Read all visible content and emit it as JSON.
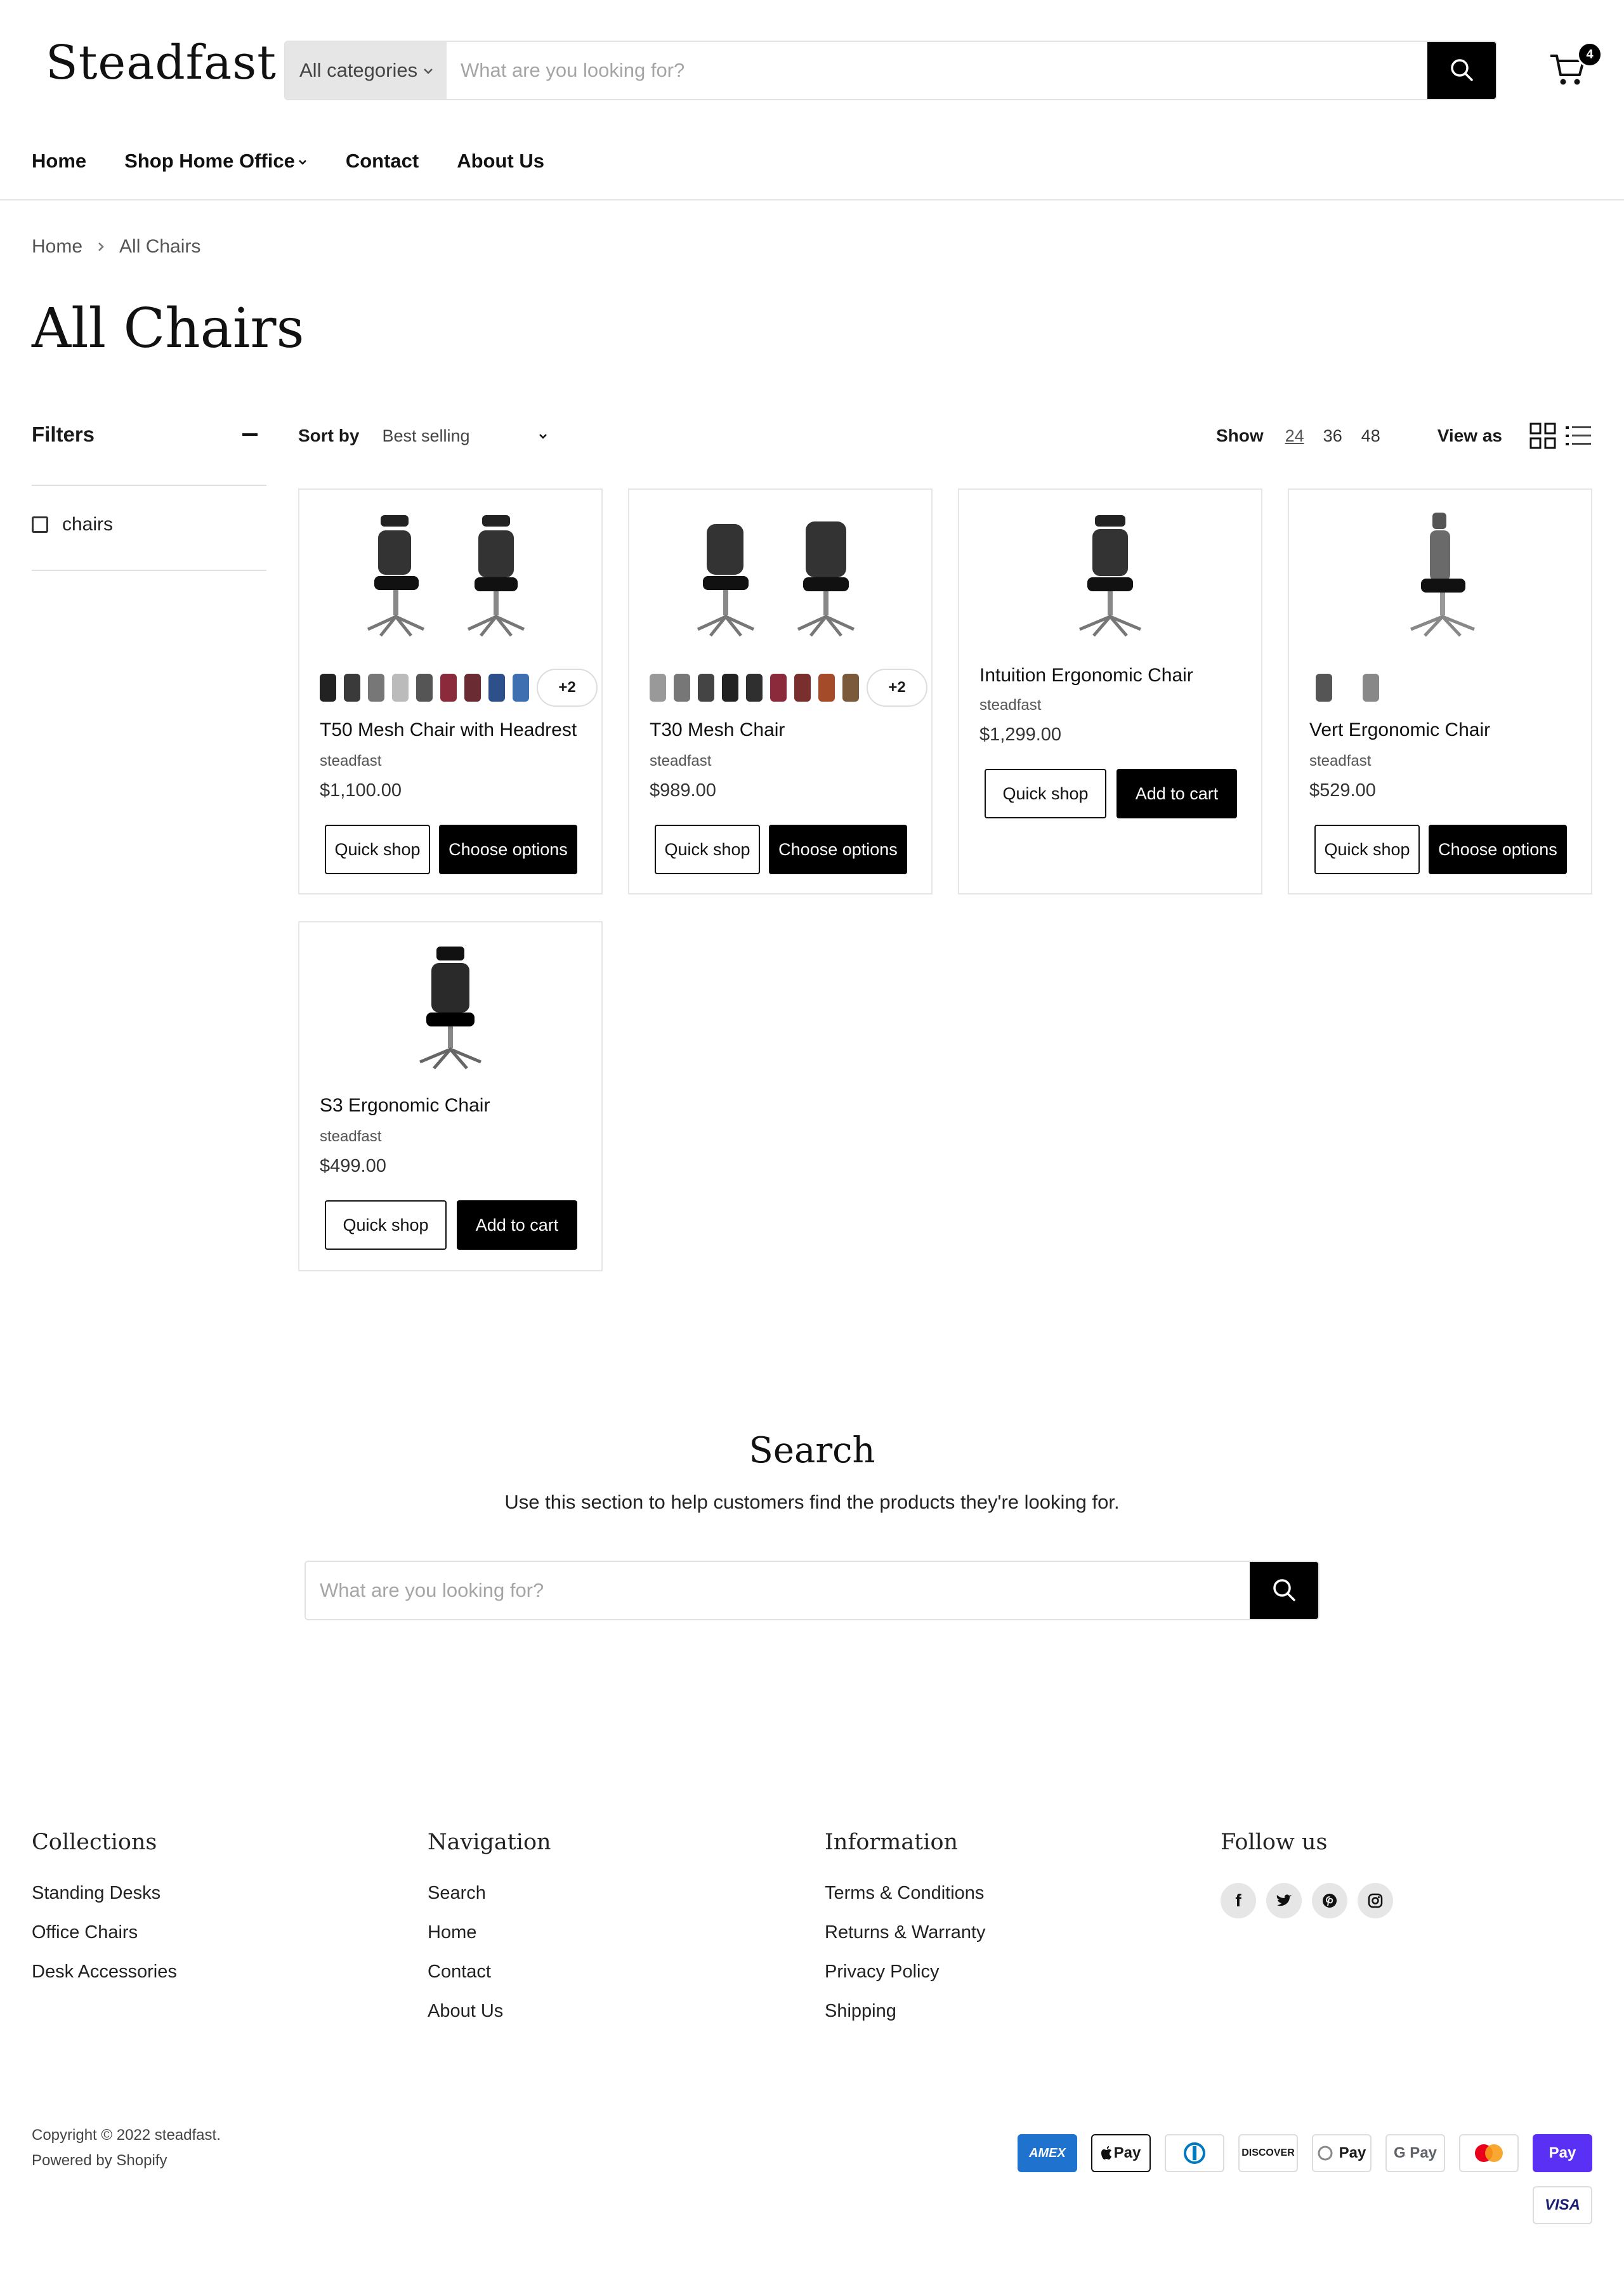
{
  "header": {
    "logo": "Steadfast",
    "category_select": "All categories",
    "search_placeholder": "What are you looking for?",
    "cart_count": "4"
  },
  "nav": {
    "items": [
      "Home",
      "Shop Home Office",
      "Contact",
      "About Us"
    ]
  },
  "breadcrumb": [
    "Home",
    "All Chairs"
  ],
  "page_title": "All Chairs",
  "filters": {
    "title": "Filters",
    "options": [
      "chairs"
    ]
  },
  "toolbar": {
    "sort_label": "Sort by",
    "sort_value": "Best selling",
    "show_label": "Show",
    "show_options": [
      "24",
      "36",
      "48"
    ],
    "view_label": "View as"
  },
  "products": [
    {
      "title": "T50 Mesh Chair with Headrest",
      "vendor": "steadfast",
      "price": "$1,100.00",
      "more_swatches": "+2",
      "buttons": [
        "Quick shop",
        "Choose options"
      ]
    },
    {
      "title": "T30 Mesh Chair",
      "vendor": "steadfast",
      "price": "$989.00",
      "more_swatches": "+2",
      "buttons": [
        "Quick shop",
        "Choose options"
      ]
    },
    {
      "title": "Intuition Ergonomic Chair",
      "vendor": "steadfast",
      "price": "$1,299.00",
      "buttons": [
        "Quick shop",
        "Add to cart"
      ]
    },
    {
      "title": "Vert Ergonomic Chair",
      "vendor": "steadfast",
      "price": "$529.00",
      "buttons": [
        "Quick shop",
        "Choose options"
      ]
    },
    {
      "title": "S3 Ergonomic Chair",
      "vendor": "steadfast",
      "price": "$499.00",
      "buttons": [
        "Quick shop",
        "Add to cart"
      ]
    }
  ],
  "search_section": {
    "title": "Search",
    "text": "Use this section to help customers find the products they're looking for.",
    "placeholder": "What are you looking for?"
  },
  "footer": {
    "collections": {
      "title": "Collections",
      "links": [
        "Standing Desks",
        "Office Chairs",
        "Desk Accessories"
      ]
    },
    "navigation": {
      "title": "Navigation",
      "links": [
        "Search",
        "Home",
        "Contact",
        "About Us"
      ]
    },
    "information": {
      "title": "Information",
      "links": [
        "Terms & Conditions",
        "Returns & Warranty",
        "Privacy Policy",
        "Shipping"
      ]
    },
    "follow": {
      "title": "Follow us",
      "icons": [
        "facebook-icon",
        "twitter-icon",
        "pinterest-icon",
        "instagram-icon"
      ]
    },
    "copyright": "Copyright © 2022 steadfast.",
    "powered": "Powered by Shopify",
    "payments": [
      "AMEX",
      "Pay",
      "",
      "DISCOVER",
      "Pay",
      "G Pay",
      "",
      "Pay",
      "VISA"
    ]
  },
  "colors": {
    "primary": "#000000",
    "border": "#e6e6e6",
    "muted_bg": "#e6e6e6"
  }
}
